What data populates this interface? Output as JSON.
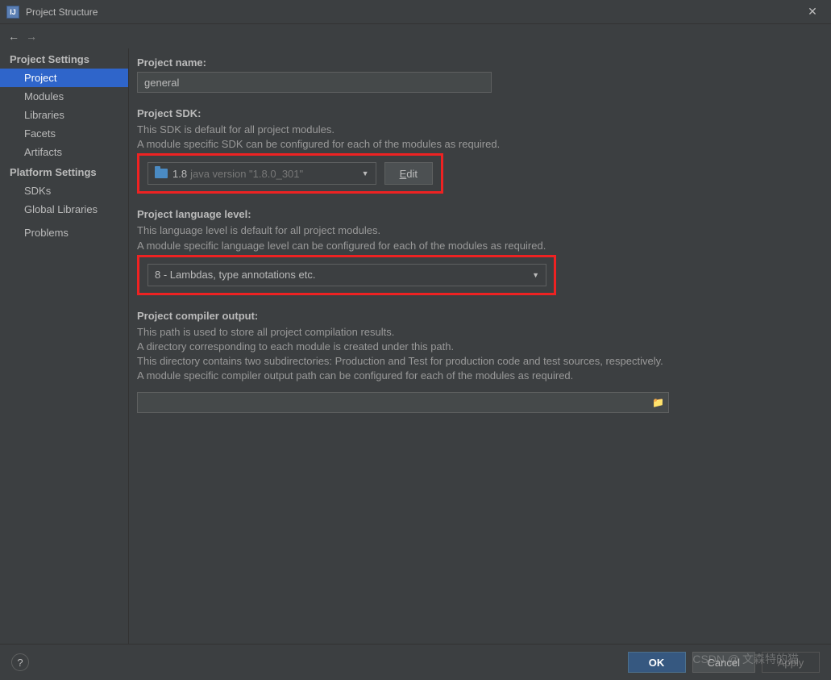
{
  "window": {
    "title": "Project Structure"
  },
  "sidebar": {
    "section1": "Project Settings",
    "items1": [
      "Project",
      "Modules",
      "Libraries",
      "Facets",
      "Artifacts"
    ],
    "section2": "Platform Settings",
    "items2": [
      "SDKs",
      "Global Libraries"
    ],
    "problems": "Problems"
  },
  "project_name": {
    "label": "Project name:",
    "value": "general"
  },
  "project_sdk": {
    "label": "Project SDK:",
    "desc1": "This SDK is default for all project modules.",
    "desc2": "A module specific SDK can be configured for each of the modules as required.",
    "selected_main": "1.8",
    "selected_sub": "java version \"1.8.0_301\"",
    "edit_label": "Edit"
  },
  "lang_level": {
    "label": "Project language level:",
    "desc1": "This language level is default for all project modules.",
    "desc2": "A module specific language level can be configured for each of the modules as required.",
    "selected": "8 - Lambdas, type annotations etc."
  },
  "compiler_output": {
    "label": "Project compiler output:",
    "desc1": "This path is used to store all project compilation results.",
    "desc2": "A directory corresponding to each module is created under this path.",
    "desc3": "This directory contains two subdirectories: Production and Test for production code and test sources, respectively.",
    "desc4": "A module specific compiler output path can be configured for each of the modules as required.",
    "value": ""
  },
  "footer": {
    "ok": "OK",
    "cancel": "Cancel",
    "apply": "Apply"
  },
  "watermark": "CSDN @ 文森特的猫"
}
